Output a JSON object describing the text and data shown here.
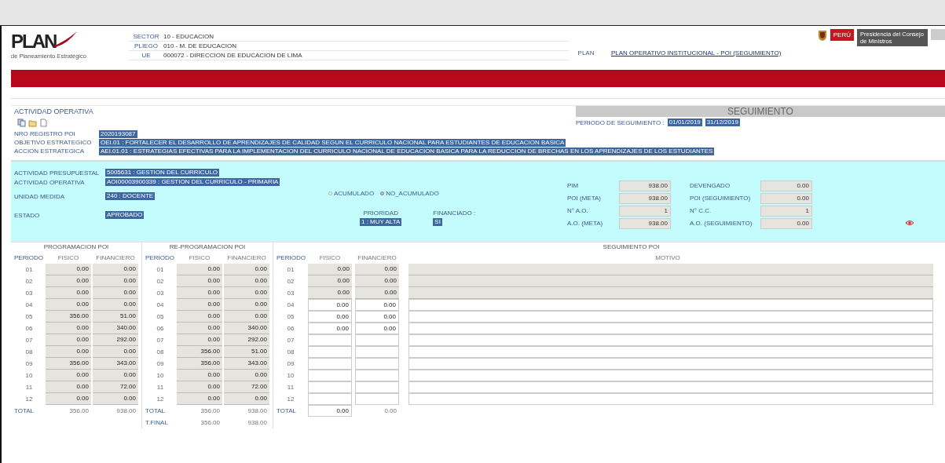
{
  "header": {
    "logo": {
      "text": "PLAN",
      "subtitle": "de Planeamiento Estratégico"
    },
    "fields": [
      {
        "label": "SECTOR",
        "value": "10 - EDUCACION"
      },
      {
        "label": "PLIEGO",
        "value": "010 - M. DE EDUCACION"
      },
      {
        "label": "UE",
        "value": "000072 - DIRECCION DE EDUCACION DE LIMA"
      }
    ],
    "plan": {
      "label": "PLAN",
      "value": "PLAN OPERATIVO INSTITUCIONAL - POI (SEGUIMIENTO)"
    },
    "government_logo": {
      "country": "PERÚ",
      "entity": "Presidencia del Consejo de Ministros"
    }
  },
  "activity": {
    "title": "ACTIVIDAD OPERATIVA",
    "tracking_title": "SEGUIMIENTO",
    "period_label": "PERIODO DE SEGUIMIENTO :",
    "period_start": "01/01/2019",
    "period_end": "31/12/2019",
    "registry": [
      {
        "label": "NRO REGISTRO POI",
        "value": "2020193087"
      },
      {
        "label": "OBJETIVO ESTRATEGICO",
        "value": "OEI.01 : FORTALECER EL DESARROLLO DE APRENDIZAJES DE CALIDAD SEGUN EL CURRICULO NACIONAL PARA ESTUDIANTES DE EDUCACION BASICA"
      },
      {
        "label": "ACCION ESTRATEGICA",
        "value": "AEI.01.01 : ESTRATEGIAS EFECTIVAS PARA LA IMPLEMENTACION DEL CURRICULO NACIONAL DE EDUCACION BASICA PARA LA REDUCCION DE BRECHAS EN LOS APRENDIZAJES DE LOS ESTUDIANTES"
      }
    ]
  },
  "detail": {
    "fields": [
      {
        "label": "ACTIVIDAD PRESUPUESTAL",
        "value": "5005631 : GESTION DEL CURRICULO"
      },
      {
        "label": "ACTIVIDAD OPERATIVA",
        "value": "AOI00003900339 : GESTION DEL CURRICULO - PRIMARIA"
      },
      {
        "label": "UNIDAD MEDIDA",
        "value": "240 : DOCENTE"
      },
      {
        "label": "ESTADO",
        "value": "APROBADO"
      }
    ],
    "accumulation": [
      {
        "label": "ACUMULADO",
        "selected": false
      },
      {
        "label": "NO_ACUMULADO",
        "selected": true
      }
    ],
    "priority": {
      "label": "PRIORIDAD",
      "value": "1 : MUY ALTA"
    },
    "financed": {
      "label": "FINANCIADO :",
      "value": "SI"
    },
    "metrics": [
      {
        "label": "PIM",
        "value": "938.00"
      },
      {
        "label": "DEVENGADO",
        "value": "0.00"
      },
      {
        "label": "POI (META)",
        "value": "938.00"
      },
      {
        "label": "POI (SEGUIMIENTO)",
        "value": "0.00"
      },
      {
        "label": "N° A.O.",
        "value": "1"
      },
      {
        "label": "N° C.C.",
        "value": "1"
      },
      {
        "label": "A.O. (META)",
        "value": "938.00"
      },
      {
        "label": "A.O. (SEGUIMIENTO)",
        "value": "0.00"
      }
    ]
  },
  "programming": {
    "title": "PROGRAMACION POI",
    "columns": [
      "PERIODO",
      "FISICO",
      "FINANCIERO"
    ],
    "rows": [
      {
        "period": "01",
        "physical": "0.00",
        "financial": "0.00"
      },
      {
        "period": "02",
        "physical": "0.00",
        "financial": "0.00"
      },
      {
        "period": "03",
        "physical": "0.00",
        "financial": "0.00"
      },
      {
        "period": "04",
        "physical": "0.00",
        "financial": "0.00"
      },
      {
        "period": "05",
        "physical": "356.00",
        "financial": "51.00"
      },
      {
        "period": "06",
        "physical": "0.00",
        "financial": "340.00"
      },
      {
        "period": "07",
        "physical": "0.00",
        "financial": "292.00"
      },
      {
        "period": "08",
        "physical": "0.00",
        "financial": "0.00"
      },
      {
        "period": "09",
        "physical": "356.00",
        "financial": "343.00"
      },
      {
        "period": "10",
        "physical": "0.00",
        "financial": "0.00"
      },
      {
        "period": "11",
        "physical": "0.00",
        "financial": "72.00"
      },
      {
        "period": "12",
        "physical": "0.00",
        "financial": "0.00"
      }
    ],
    "totals": [
      {
        "label": "TOTAL",
        "physical": "356.00",
        "financial": "938.00"
      }
    ]
  },
  "reprogramming": {
    "title": "RE-PROGRAMACION POI",
    "columns": [
      "PERIODO",
      "FISICO",
      "FINANCIERO"
    ],
    "rows": [
      {
        "period": "01",
        "physical": "0.00",
        "financial": "0.00"
      },
      {
        "period": "02",
        "physical": "0.00",
        "financial": "0.00"
      },
      {
        "period": "03",
        "physical": "0.00",
        "financial": "0.00"
      },
      {
        "period": "04",
        "physical": "0.00",
        "financial": "0.00"
      },
      {
        "period": "05",
        "physical": "0.00",
        "financial": "0.00"
      },
      {
        "period": "06",
        "physical": "0.00",
        "financial": "340.00"
      },
      {
        "period": "07",
        "physical": "0.00",
        "financial": "292.00"
      },
      {
        "period": "08",
        "physical": "356.00",
        "financial": "51.00"
      },
      {
        "period": "09",
        "physical": "356.00",
        "financial": "343.00"
      },
      {
        "period": "10",
        "physical": "0.00",
        "financial": "0.00"
      },
      {
        "period": "11",
        "physical": "0.00",
        "financial": "72.00"
      },
      {
        "period": "12",
        "physical": "0.00",
        "financial": "0.00"
      }
    ],
    "totals": [
      {
        "label": "TOTAL",
        "physical": "356.00",
        "financial": "938.00"
      },
      {
        "label": "T.FINAL",
        "physical": "356.00",
        "financial": "938.00"
      }
    ]
  },
  "tracking": {
    "title": "SEGUIMIENTO POI",
    "columns": [
      "PERIODO",
      "FISICO",
      "FINANCIERO",
      "MOTIVO"
    ],
    "rows": [
      {
        "period": "01",
        "physical": "0.00",
        "financial": "0.00",
        "disabled": true
      },
      {
        "period": "02",
        "physical": "0.00",
        "financial": "0.00",
        "disabled": true
      },
      {
        "period": "03",
        "physical": "0.00",
        "financial": "0.00",
        "disabled": true
      },
      {
        "period": "04",
        "physical": "0.00",
        "financial": "0.00",
        "disabled": false
      },
      {
        "period": "05",
        "physical": "0.00",
        "financial": "0.00",
        "disabled": false
      },
      {
        "period": "06",
        "physical": "0.00",
        "financial": "0.00",
        "disabled": false
      },
      {
        "period": "07",
        "disabled": false
      },
      {
        "period": "08",
        "disabled": false
      },
      {
        "period": "09",
        "disabled": false
      },
      {
        "period": "10",
        "disabled": false
      },
      {
        "period": "11",
        "disabled": false
      },
      {
        "period": "12",
        "disabled": false
      }
    ],
    "totals": [
      {
        "label": "TOTAL",
        "physical": "0.00",
        "financial": "0.00"
      }
    ]
  }
}
